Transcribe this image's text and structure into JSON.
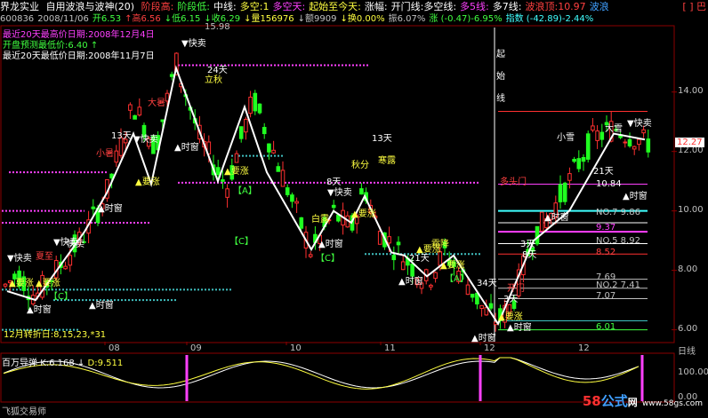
{
  "title_bar": {
    "app_name": "界龙实业",
    "tabs": [
      "自用波浪与波神(20)"
    ],
    "items": [
      {
        "text": "阶段高:",
        "color": "#ff4040"
      },
      {
        "text": "阶段低:",
        "color": "#40ff40"
      },
      {
        "text": "中线:",
        "color": "#ffffff"
      },
      {
        "text": "多空:1",
        "color": "#ffff40"
      },
      {
        "text": "多空天:",
        "color": "#ff40ff"
      },
      {
        "text": "起始至今天:",
        "color": "#ffff40"
      },
      {
        "text": "涨幅:",
        "color": "#ffffff"
      },
      {
        "text": "开门线:多空线:",
        "color": "#ffffff"
      },
      {
        "text": "多5线:",
        "color": "#ff40ff"
      },
      {
        "text": "多7线:",
        "color": "#ffffff"
      },
      {
        "text": "波浪顶:10.97",
        "color": "#ff4040"
      },
      {
        "text": "波浪",
        "color": "#40a0ff"
      }
    ],
    "close_glyph": "[ ] 巴"
  },
  "quote_bar": [
    {
      "text": "600836",
      "color": "#c0c0c0"
    },
    {
      "text": "2008/11/06",
      "color": "#c0c0c0"
    },
    {
      "text": "开6.53",
      "color": "#40ff40"
    },
    {
      "text": "↑高6.56",
      "color": "#ff4040"
    },
    {
      "text": "↓低6.15",
      "color": "#40ff40"
    },
    {
      "text": "↓收6.29",
      "color": "#40ff40"
    },
    {
      "text": "↓量156976",
      "color": "#ffff40"
    },
    {
      "text": "↓额9909",
      "color": "#c0c0c0"
    },
    {
      "text": "↓换0.00%",
      "color": "#ffff40"
    },
    {
      "text": "振6.07%",
      "color": "#c0c0c0"
    },
    {
      "text": "涨 (-0.47)-6.95%",
      "color": "#40ff40"
    },
    {
      "text": "指数 (-42.89)-2.44%",
      "color": "#40ffff"
    }
  ],
  "info_lines": [
    {
      "text": "最近20天最高价日期:2008年12月4日",
      "color": "#ff40ff"
    },
    {
      "text": "开盘预测最低价:6.40 ↑",
      "color": "#40ff40"
    },
    {
      "text": "最近20天最低价日期:2008年11月7日",
      "color": "#ffffff"
    }
  ],
  "price_axis": [
    "14.00",
    "12.00",
    "10.00",
    "8.00",
    "6.00"
  ],
  "current_price": "12.27",
  "price_top_label": "15.98",
  "right_levels": [
    {
      "text": "10.84",
      "color": "#ffffff"
    },
    {
      "text": "NO.7 9.86",
      "color": "#c0c0c0"
    },
    {
      "text": "9.37",
      "color": "#ff40ff"
    },
    {
      "text": "NO.5 8.92",
      "color": "#c0c0c0"
    },
    {
      "text": "8.52",
      "color": "#ff4040"
    },
    {
      "text": "7.69",
      "color": "#c0c0c0"
    },
    {
      "text": "NO.2 7.41",
      "color": "#c0c0c0"
    },
    {
      "text": "7.07",
      "color": "#c0c0c0"
    },
    {
      "text": "6.01",
      "color": "#40ff40"
    }
  ],
  "months": [
    "08",
    "09",
    "10",
    "11",
    "12"
  ],
  "axis_right_label": "日线",
  "turn_line": "12月转折日:8,15,23,*31",
  "vertical_text": [
    "起",
    "始",
    "线"
  ],
  "annotations": [
    {
      "t": "▼快卖",
      "c": "#ffffff"
    },
    {
      "t": "24天",
      "c": "#ffffff"
    },
    {
      "t": "立秋",
      "c": "#ffff40"
    },
    {
      "t": "大暑",
      "c": "#ff4040"
    },
    {
      "t": "13天",
      "c": "#ffffff"
    },
    {
      "t": "▼快卖",
      "c": "#ffffff"
    },
    {
      "t": "小暑",
      "c": "#ff4040"
    },
    {
      "t": "▲时窗",
      "c": "#ffffff"
    },
    {
      "t": "▲要涨",
      "c": "#ffff40"
    },
    {
      "t": "▲时窗",
      "c": "#ffffff"
    },
    {
      "t": "▲要涨",
      "c": "#ffff40"
    },
    {
      "t": "【A】",
      "c": "#40ff40"
    },
    {
      "t": "▼快卖",
      "c": "#ffffff"
    },
    {
      "t": "秋分",
      "c": "#ffff40"
    },
    {
      "t": "寒露",
      "c": "#ffff40"
    },
    {
      "t": "13天",
      "c": "#ffffff"
    },
    {
      "t": "8天",
      "c": "#ffffff"
    },
    {
      "t": "白露",
      "c": "#ffff40"
    },
    {
      "t": "▲要涨",
      "c": "#ffff40"
    },
    {
      "t": "▲时窗",
      "c": "#ffffff"
    },
    {
      "t": "【C】",
      "c": "#40ff40"
    },
    {
      "t": "▲要涨",
      "c": "#ffff40"
    },
    {
      "t": "21天",
      "c": "#ffffff"
    },
    {
      "t": "霜降",
      "c": "#ffff40"
    },
    {
      "t": "▲要涨",
      "c": "#ffff40"
    },
    {
      "t": "【A】",
      "c": "#40ff40"
    },
    {
      "t": "34天",
      "c": "#ffffff"
    },
    {
      "t": "▲时窗",
      "c": "#ffffff"
    },
    {
      "t": "▲时窗",
      "c": "#ffffff"
    },
    {
      "t": "▲要涨",
      "c": "#ffff40"
    },
    {
      "t": "【C】",
      "c": "#40ff40"
    },
    {
      "t": "8天",
      "c": "#ffffff"
    },
    {
      "t": "▲时窗",
      "c": "#ffffff"
    },
    {
      "t": "▲时窗",
      "c": "#ffffff"
    },
    {
      "t": "3天",
      "c": "#ffffff"
    },
    {
      "t": "开门",
      "c": "#ff4040"
    },
    {
      "t": "多头门",
      "c": "#ff4040"
    },
    {
      "t": "小雪",
      "c": "#ffffff"
    },
    {
      "t": "大雪",
      "c": "#ffffff"
    },
    {
      "t": "▼快卖",
      "c": "#ffffff"
    },
    {
      "t": "21天",
      "c": "#ffffff"
    },
    {
      "t": "▲时窗",
      "c": "#ffffff"
    },
    {
      "t": "3天",
      "c": "#ffffff"
    },
    {
      "t": "▼快卖",
      "c": "#ffffff"
    },
    {
      "t": "夏至",
      "c": "#ff4040"
    },
    {
      "t": "▼快卖",
      "c": "#ffffff"
    },
    {
      "t": "快卖",
      "c": "#ffffff"
    },
    {
      "t": "▲要涨",
      "c": "#ffff40"
    },
    {
      "t": "▲时窗",
      "c": "#ffffff"
    },
    {
      "t": "【C】",
      "c": "#40ff40"
    },
    {
      "t": "▲要涨",
      "c": "#ffff40"
    },
    {
      "t": "▲时窗",
      "c": "#ffffff"
    }
  ],
  "oscillator": {
    "label": "百万导弹",
    "k": "K:6.168",
    "d": "D:9.511",
    "arrow": "↓"
  },
  "osc_axis": [
    "100.00",
    "0.00"
  ],
  "watermark": {
    "num": "58",
    "word": "公式",
    "suffix": "网",
    "domain": "www.58gs.com"
  },
  "brand": "飞狐交易师",
  "colors": {
    "up": "#ff3030",
    "down": "#20ff20",
    "zig": "#ffffff",
    "magenta": "#ff40ff"
  }
}
